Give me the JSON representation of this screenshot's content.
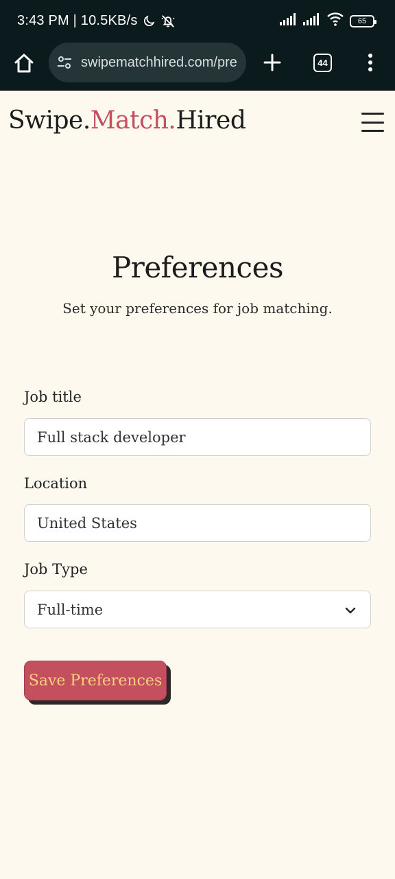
{
  "status_bar": {
    "time_speed": "3:43 PM | 10.5KB/s",
    "battery": "65",
    "icons": [
      "moon-icon",
      "bell-off-icon",
      "signal-icon",
      "signal-icon",
      "wifi-icon",
      "battery-icon"
    ]
  },
  "browser": {
    "url": "swipematchhired.com/pre",
    "tab_count": "44",
    "icons": [
      "home-icon",
      "tune-icon",
      "plus-icon",
      "tabs-icon",
      "more-vert-icon"
    ]
  },
  "header": {
    "logo_part1": "Swipe.",
    "logo_part2": "Match.",
    "logo_part3": "Hired",
    "accent_color": "#c4505f",
    "menu_icon": "hamburger-menu-icon"
  },
  "main": {
    "title": "Preferences",
    "subtitle": "Set your preferences for job matching.",
    "fields": [
      {
        "label": "Job title",
        "value": "Full stack developer"
      },
      {
        "label": "Location",
        "value": "United States"
      },
      {
        "label": "Job Type",
        "value": "Full-time"
      }
    ],
    "save_label": "Save Preferences",
    "button_color": "#c4505f",
    "button_text_color": "#f6d27a"
  }
}
